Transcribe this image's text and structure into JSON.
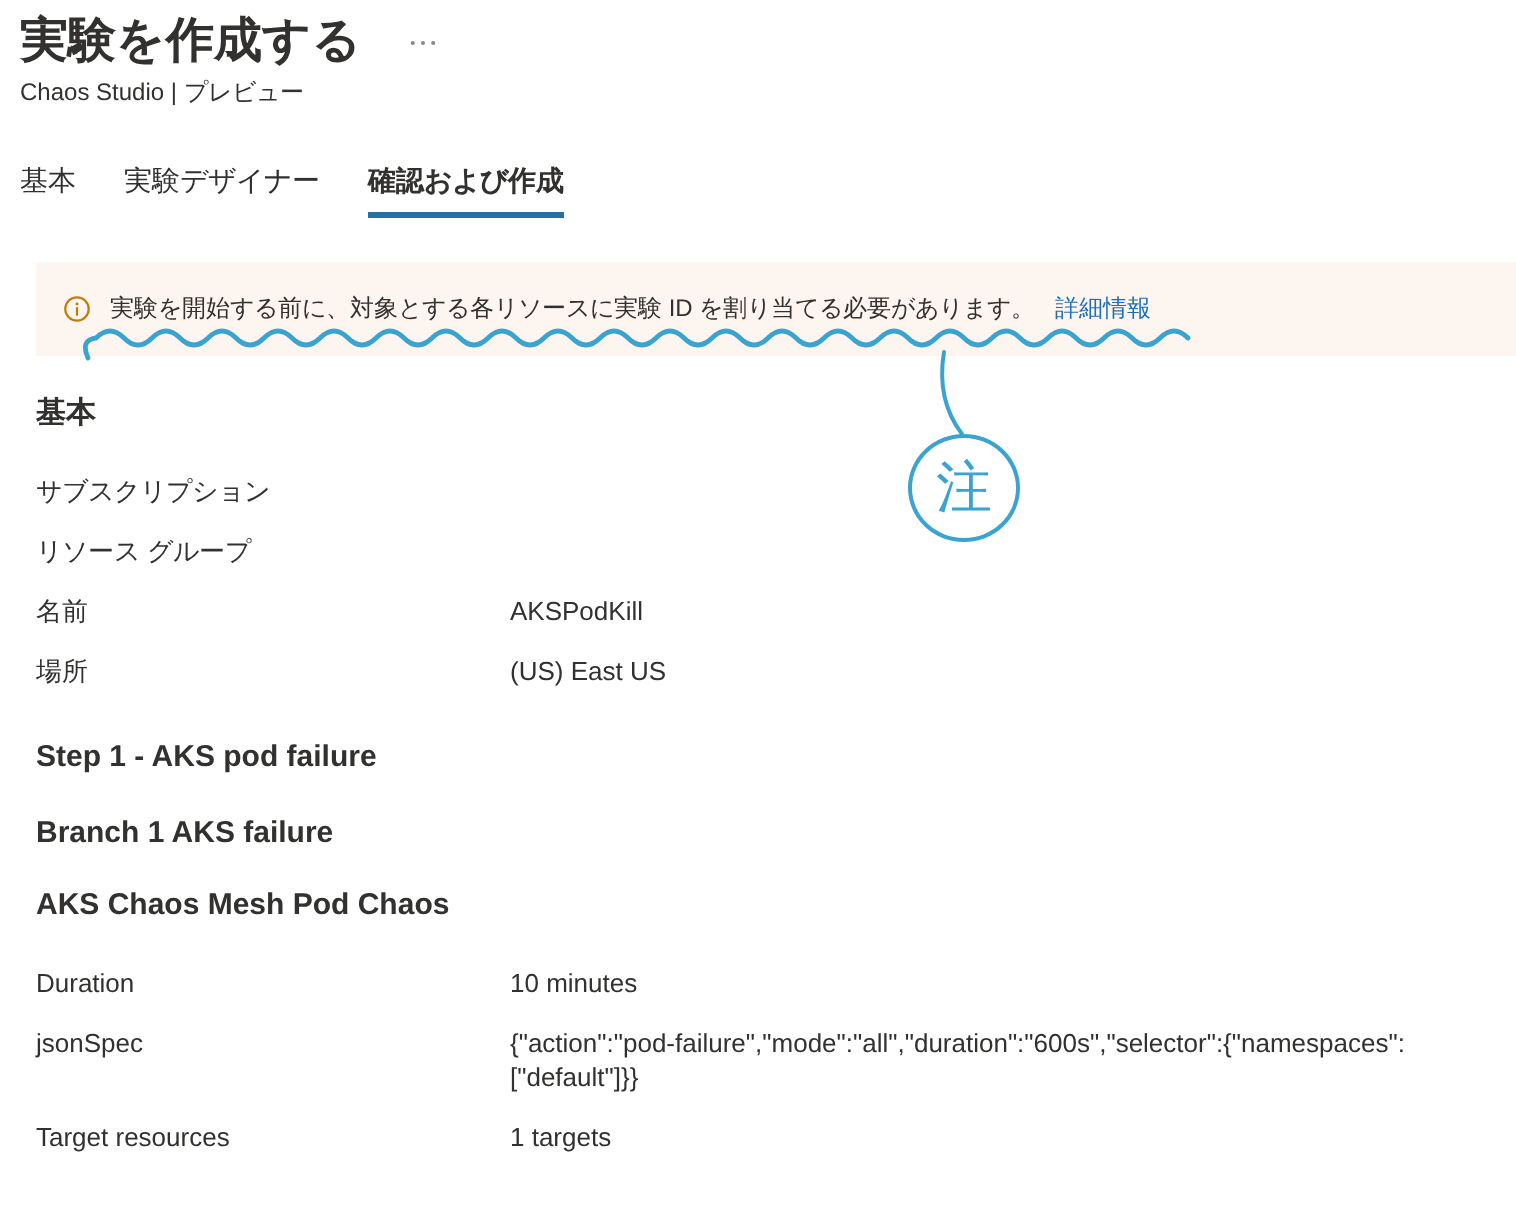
{
  "header": {
    "title": "実験を作成する",
    "subtitle": "Chaos Studio | プレビュー"
  },
  "tabs": [
    {
      "label": "基本",
      "selected": false
    },
    {
      "label": "実験デザイナー",
      "selected": false
    },
    {
      "label": "確認および作成",
      "selected": true
    }
  ],
  "notice": {
    "text": "実験を開始する前に、対象とする各リソースに実験 ID を割り当てる必要があります。",
    "link": "詳細情報"
  },
  "annotation": {
    "mark": "注"
  },
  "sections": [
    {
      "heading": "基本",
      "rows": [
        {
          "label": "サブスクリプション"
        },
        {
          "label": "リソース グループ"
        },
        {
          "label": "名前",
          "value": "AKSPodKill"
        },
        {
          "label": "場所",
          "value": "(US) East US"
        }
      ]
    },
    {
      "heading": "Step 1 - AKS pod failure"
    },
    {
      "heading": "Branch 1 AKS failure"
    },
    {
      "heading": "AKS Chaos Mesh Pod Chaos",
      "rows": [
        {
          "label": "Duration",
          "value": "10 minutes"
        },
        {
          "label": "jsonSpec",
          "value": "{\"action\":\"pod-failure\",\"mode\":\"all\",\"duration\":\"600s\",\"selector\":{\"namespaces\":[\"default\"]}}"
        },
        {
          "label": "Target resources",
          "value": "1 targets"
        }
      ]
    }
  ]
}
